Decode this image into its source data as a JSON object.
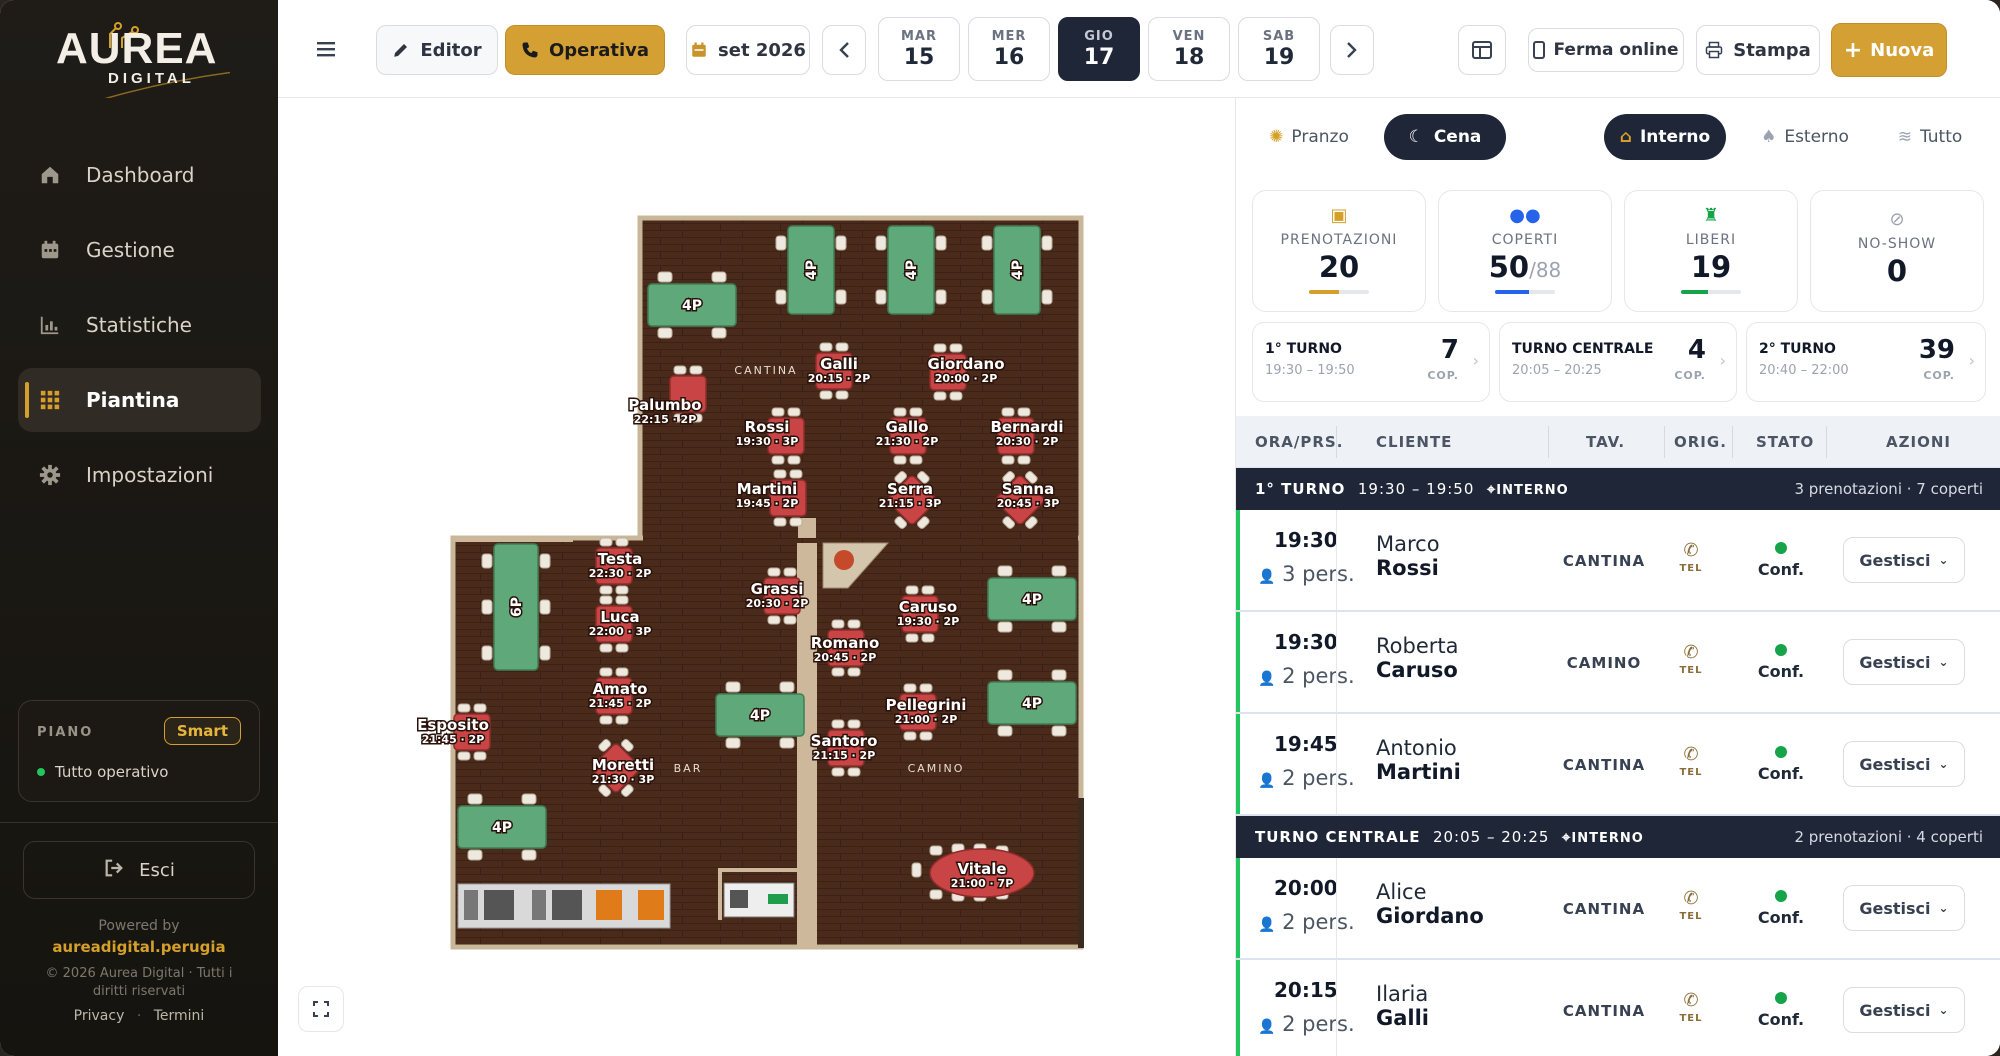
{
  "sidebar": {
    "brand": "AUREA",
    "brand_sub": "DIGITAL",
    "items": [
      {
        "label": "Dashboard",
        "icon": "home-icon"
      },
      {
        "label": "Gestione",
        "icon": "calendar-icon"
      },
      {
        "label": "Statistiche",
        "icon": "chart-icon"
      },
      {
        "label": "Piantina",
        "icon": "grid-icon"
      },
      {
        "label": "Impostazioni",
        "icon": "gear-icon"
      }
    ],
    "piano_label": "PIANO",
    "piano_badge": "Smart",
    "piano_status": "Tutto operativo",
    "logout": "Esci",
    "powered_by": "Powered by",
    "powered_link": "aureadigital.perugia",
    "copyright": "© 2026 Aurea Digital · Tutti i diritti riservati",
    "privacy": "Privacy",
    "sep": "·",
    "terms": "Termini"
  },
  "topbar": {
    "editor": "Editor",
    "operativa": "Operativa",
    "month": "set 2026",
    "days": [
      {
        "dow": "MAR",
        "num": "15"
      },
      {
        "dow": "MER",
        "num": "16"
      },
      {
        "dow": "GIO",
        "num": "17"
      },
      {
        "dow": "VEN",
        "num": "18"
      },
      {
        "dow": "SAB",
        "num": "19"
      }
    ],
    "ferma": "Ferma online",
    "stampa": "Stampa",
    "nuova": "Nuova"
  },
  "floor": {
    "zones": {
      "cantina": "CANTINA",
      "bar": "BAR",
      "camino": "CAMINO"
    },
    "free_tables": [
      "4P",
      "4P",
      "4P",
      "4P",
      "6P",
      "4P",
      "4P",
      "4P",
      "4P"
    ],
    "reservations": [
      {
        "name": "Galli",
        "info": "20:15 · 2P"
      },
      {
        "name": "Giordano",
        "info": "20:00 · 2P"
      },
      {
        "name": "Palumbo",
        "info": "22:15 · 2P"
      },
      {
        "name": "Rossi",
        "info": "19:30 · 3P"
      },
      {
        "name": "Gallo",
        "info": "21:30 · 2P"
      },
      {
        "name": "Bernardi",
        "info": "20:30 · 2P"
      },
      {
        "name": "Martini",
        "info": "19:45 · 2P"
      },
      {
        "name": "Serra",
        "info": "21:15 · 3P"
      },
      {
        "name": "Sanna",
        "info": "20:45 · 3P"
      },
      {
        "name": "Testa",
        "info": "22:30 · 2P"
      },
      {
        "name": "Grassi",
        "info": "20:30 · 2P"
      },
      {
        "name": "Luca",
        "info": "22:00 · 3P"
      },
      {
        "name": "Caruso",
        "info": "19:30 · 2P"
      },
      {
        "name": "Romano",
        "info": "20:45 · 2P"
      },
      {
        "name": "Amato",
        "info": "21:45 · 2P"
      },
      {
        "name": "Pellegrini",
        "info": "21:00 · 2P"
      },
      {
        "name": "Esposito",
        "info": "21:45 · 2P"
      },
      {
        "name": "Santoro",
        "info": "21:15 · 2P"
      },
      {
        "name": "Moretti",
        "info": "21:30 · 3P"
      },
      {
        "name": "Vitale",
        "info": "21:00 · 7P"
      }
    ]
  },
  "filters": {
    "pranzo": "Pranzo",
    "cena": "Cena",
    "interno": "Interno",
    "esterno": "Esterno",
    "tutto": "Tutto"
  },
  "stats": [
    {
      "label": "PRENOTAZIONI",
      "value": "20",
      "bar_color": "#d4a02a",
      "fill": 0.5
    },
    {
      "label": "COPERTI",
      "value": "50",
      "suffix": "/88",
      "bar_color": "#2563eb",
      "fill": 0.57
    },
    {
      "label": "LIBERI",
      "value": "19",
      "bar_color": "#16a34a",
      "fill": 0.45
    },
    {
      "label": "NO-SHOW",
      "value": "0"
    }
  ],
  "turni": [
    {
      "name": "1° TURNO",
      "range": "19:30 – 19:50",
      "count": "7",
      "unit": "COP."
    },
    {
      "name": "TURNO CENTRALE",
      "range": "20:05 – 20:25",
      "count": "4",
      "unit": "COP."
    },
    {
      "name": "2° TURNO",
      "range": "20:40 – 22:00",
      "count": "39",
      "unit": "COP."
    }
  ],
  "table": {
    "headers": [
      "ORA/PRS.",
      "CLIENTE",
      "TAV.",
      "ORIG.",
      "STATO",
      "AZIONI"
    ],
    "groups": [
      {
        "name": "1° TURNO",
        "range": "19:30 – 19:50",
        "zone": "INTERNO",
        "summary": "3 prenotazioni · 7 coperti"
      },
      {
        "name": "TURNO CENTRALE",
        "range": "20:05 – 20:25",
        "zone": "INTERNO",
        "summary": "2 prenotazioni · 4 coperti"
      }
    ],
    "rows": [
      {
        "time": "19:30",
        "pers": "3 pers.",
        "first": "Marco",
        "last": "Rossi",
        "tav": "CANTINA",
        "orig": "TEL",
        "stato": "Conf.",
        "action": "Gestisci"
      },
      {
        "time": "19:30",
        "pers": "2 pers.",
        "first": "Roberta",
        "last": "Caruso",
        "tav": "CAMINO",
        "orig": "TEL",
        "stato": "Conf.",
        "action": "Gestisci"
      },
      {
        "time": "19:45",
        "pers": "2 pers.",
        "first": "Antonio",
        "last": "Martini",
        "tav": "CANTINA",
        "orig": "TEL",
        "stato": "Conf.",
        "action": "Gestisci"
      },
      {
        "time": "20:00",
        "pers": "2 pers.",
        "first": "Alice",
        "last": "Giordano",
        "tav": "CANTINA",
        "orig": "TEL",
        "stato": "Conf.",
        "action": "Gestisci"
      },
      {
        "time": "20:15",
        "pers": "2 pers.",
        "first": "Ilaria",
        "last": "Galli",
        "tav": "CANTINA",
        "orig": "TEL",
        "stato": "Conf.",
        "action": "Gestisci"
      }
    ]
  }
}
